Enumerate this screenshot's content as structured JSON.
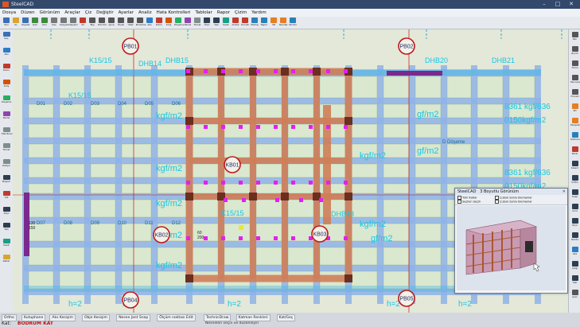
{
  "window": {
    "title": "SteelCAD",
    "min": "–",
    "max": "□",
    "close": "✕"
  },
  "menu": [
    "Dosya",
    "Düzen",
    "Görünüm",
    "Araçlar",
    "Çiz",
    "Değiştir",
    "Ayarlar",
    "Analiz",
    "Hata Kontrolleri",
    "Tablolar",
    "Rapor",
    "Çizim",
    "Yardım"
  ],
  "toolbar": [
    {
      "label": "Yeni",
      "color": "#3a6fb5"
    },
    {
      "label": "Aç",
      "color": "#d9a531"
    },
    {
      "label": "Kaydet",
      "color": "#3a6fb5"
    },
    {
      "label": "Geri",
      "color": "#3d8a3d"
    },
    {
      "label": "İleri",
      "color": "#3d8a3d"
    },
    {
      "label": "Kes",
      "color": "#777"
    },
    {
      "label": "Kopyala",
      "color": "#777"
    },
    {
      "label": "Yapıştır",
      "color": "#777"
    },
    {
      "label": "Sil",
      "color": "#c0392b"
    },
    {
      "label": "Taşı",
      "color": "#555"
    },
    {
      "label": "Döndür",
      "color": "#555"
    },
    {
      "label": "Ayna",
      "color": "#555"
    },
    {
      "label": "Ölçek",
      "color": "#555"
    },
    {
      "label": "Uzat",
      "color": "#555"
    },
    {
      "label": "Budama",
      "color": "#555"
    },
    {
      "label": "Aks",
      "color": "#2b7cc7"
    },
    {
      "label": "Kolon",
      "color": "#c0392b"
    },
    {
      "label": "Kiriş",
      "color": "#d35400"
    },
    {
      "label": "Döşeme",
      "color": "#27ae60"
    },
    {
      "label": "Perde",
      "color": "#8e44ad"
    },
    {
      "label": "Temel",
      "color": "#7f8c8d"
    },
    {
      "label": "Ölçü",
      "color": "#2c3e50"
    },
    {
      "label": "Yazı",
      "color": "#2c3e50"
    },
    {
      "label": "Kesit",
      "color": "#16a085"
    },
    {
      "label": "Analiz",
      "color": "#c0392b"
    },
    {
      "label": "Donatı",
      "color": "#c0392b"
    },
    {
      "label": "Metraj",
      "color": "#2980b9"
    },
    {
      "label": "Rapor",
      "color": "#2980b9"
    },
    {
      "label": "3D",
      "color": "#e67e22"
    },
    {
      "label": "Render",
      "color": "#e67e22"
    },
    {
      "label": "Yardım",
      "color": "#2980b9"
    }
  ],
  "left_tools": [
    {
      "label": "Seç",
      "color": "#3a6fb5"
    },
    {
      "label": "Aks",
      "color": "#2b7cc7"
    },
    {
      "label": "Kolon",
      "color": "#c0392b"
    },
    {
      "label": "Kiriş",
      "color": "#d35400"
    },
    {
      "label": "Döşeme",
      "color": "#27ae60"
    },
    {
      "label": "Perde",
      "color": "#8e44ad"
    },
    {
      "label": "Merdiven",
      "color": "#7f8c8d"
    },
    {
      "label": "Temel",
      "color": "#7f8c8d"
    },
    {
      "label": "Radye",
      "color": "#7f8c8d"
    },
    {
      "label": "Boşluk",
      "color": "#2c3e50"
    },
    {
      "label": "Yük",
      "color": "#c0392b"
    },
    {
      "label": "Ölçü",
      "color": "#2c3e50"
    },
    {
      "label": "Yazı",
      "color": "#2c3e50"
    },
    {
      "label": "Kesit",
      "color": "#16a085"
    },
    {
      "label": "Katlar",
      "color": "#d9a531"
    }
  ],
  "right_tools": [
    {
      "label": "Pan",
      "color": "#555"
    },
    {
      "label": "Zoom",
      "color": "#555"
    },
    {
      "label": "Tümü",
      "color": "#555"
    },
    {
      "label": "Pencere",
      "color": "#555"
    },
    {
      "label": "Önceki",
      "color": "#555"
    },
    {
      "label": "3D",
      "color": "#e67e22"
    },
    {
      "label": "Perspektif",
      "color": "#e67e22"
    },
    {
      "label": "Katman",
      "color": "#2980b9"
    },
    {
      "label": "Renk",
      "color": "#c0392b"
    },
    {
      "label": "Kalem",
      "color": "#2c3e50"
    },
    {
      "label": "Ortho",
      "color": "#2c3e50"
    },
    {
      "label": "Snap",
      "color": "#2c3e50"
    },
    {
      "label": "Grid",
      "color": "#2c3e50"
    },
    {
      "label": "Ölçü",
      "color": "#2c3e50"
    },
    {
      "label": "Nokta",
      "color": "#2c3e50"
    },
    {
      "label": "Aks",
      "color": "#2b7cc7"
    },
    {
      "label": "Çizgi",
      "color": "#2c3e50"
    },
    {
      "label": "Yazı",
      "color": "#2c3e50"
    },
    {
      "label": "Ayar",
      "color": "#555"
    }
  ],
  "plan": {
    "axis_labels_x": [
      "PB01",
      "PB02"
    ],
    "axis_labels_x_bottom": [
      "PB04",
      "PB05"
    ],
    "axis_labels_inner": [
      "KB01",
      "KB02",
      "KB03"
    ],
    "beam_labels": [
      "DHB14",
      "DHB15",
      "DHB20",
      "DHB21",
      "DHB43",
      "K15/15",
      "K15/15",
      "K15/15"
    ],
    "slab_labels": [
      "D01",
      "D02",
      "D03",
      "D04",
      "D05",
      "D06",
      "D07",
      "D08",
      "D09",
      "D10",
      "D11",
      "D12"
    ],
    "load_texts": [
      "kgf/m2",
      "gf/m2",
      "gf/m2",
      "gf/m2",
      "kgf/m2",
      "kgf/m2",
      "kgf/m2",
      "kgf/m2",
      "kgf/m2",
      "kgf/m2"
    ],
    "right_load_texts": [
      "8361 kgf/636",
      "0150kgf/m2",
      "8361 kgf/636",
      "0150kgf/m2"
    ],
    "slab_thickness": [
      "h=2",
      "h=2",
      "h=2",
      "h=2",
      "h=2"
    ],
    "dimension_small": [
      "60",
      "200",
      "130",
      "150"
    ],
    "label_doseme": "D Döşeme",
    "colors": {
      "canvas_bg": "#e3e8d8",
      "slab": "#d9e8cf",
      "beam": "#8fb3e6",
      "column_red": "#cf7e56",
      "axis": "#49b7e6",
      "select": "#e41ff0",
      "label_cyan": "#18c6e6",
      "marker": "#c0181c"
    }
  },
  "window3d": {
    "title": "3 Boyutlu Görünüm",
    "app": "SteelCAD",
    "close": "✕",
    "options": [
      "Tüm Katlar",
      "Seçilen Seçili",
      "Çubuk Sonlu Elemanlar",
      "Çubuk Sonlu Elemanlar"
    ]
  },
  "status": {
    "buttons": [
      "Ortho",
      "Kutuphane",
      "Aks Kesişim",
      "Obje Kesişim",
      "Nesne Jant Snap",
      "Ölçüm noktası Edit",
      "TechnicDraw",
      "Katman Renkleri",
      "Kat/Geç"
    ],
    "floor_label": "Kat:",
    "floor": "BODRUM KAT",
    "hint": "Nesneleri seçin ve düzenleyin"
  }
}
